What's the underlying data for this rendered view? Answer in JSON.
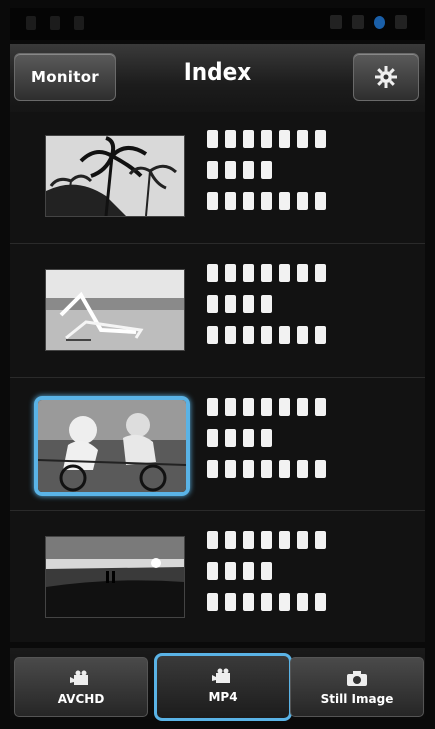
{
  "header": {
    "monitor_label": "Monitor",
    "title": "Index",
    "settings_icon": "gear-icon"
  },
  "list": {
    "items": [
      {
        "thumbnail": "palm-trees",
        "selected": false
      },
      {
        "thumbnail": "beach-chair",
        "selected": false
      },
      {
        "thumbnail": "cyclists",
        "selected": true
      },
      {
        "thumbnail": "sunset-beach",
        "selected": false
      }
    ]
  },
  "tabs": [
    {
      "label": "AVCHD",
      "icon": "video-camera-icon",
      "active": false
    },
    {
      "label": "MP4",
      "icon": "video-camera-icon",
      "active": true
    },
    {
      "label": "Still Image",
      "icon": "camera-icon",
      "active": false
    }
  ],
  "colors": {
    "accent": "#5ab3e6",
    "background": "#121212"
  }
}
